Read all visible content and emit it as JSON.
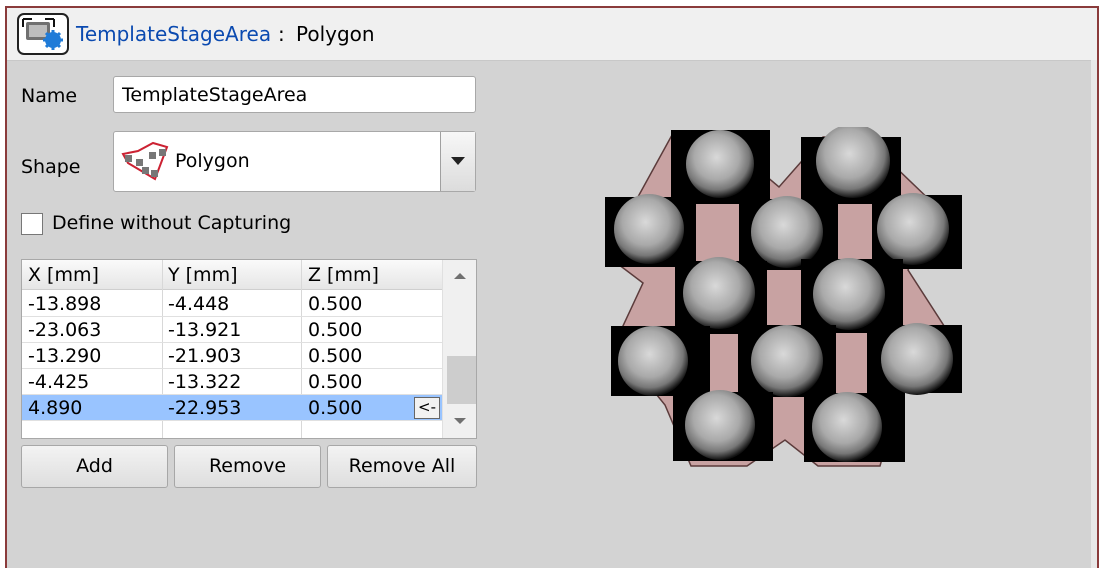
{
  "window": {
    "object_name": "TemplateStageArea",
    "separator": ":",
    "object_type": "Polygon",
    "icon": "stage-area-gear-icon"
  },
  "form": {
    "name_label": "Name",
    "name_value": "TemplateStageArea",
    "shape_label": "Shape",
    "shape_value": "Polygon",
    "shape_icon": "polygon-shape-icon",
    "define_without_capturing_label": "Define without Capturing",
    "define_without_capturing_checked": false
  },
  "coordinates": {
    "headers": [
      "X [mm]",
      "Y [mm]",
      "Z [mm]"
    ],
    "rows": [
      [
        "-13.898",
        "-4.448",
        "0.500"
      ],
      [
        "-23.063",
        "-13.921",
        "0.500"
      ],
      [
        "-13.290",
        "-21.903",
        "0.500"
      ],
      [
        "-4.425",
        "-13.322",
        "0.500"
      ],
      [
        "4.890",
        "-22.953",
        "0.500"
      ]
    ],
    "selected_row_index": 4,
    "row_action_label": "<-"
  },
  "buttons": {
    "add": "Add",
    "remove": "Remove",
    "remove_all": "Remove All"
  },
  "colors": {
    "link": "#0b4ab0",
    "selection": "#99c4ff",
    "polygon_fill": "#c8a2a2",
    "frame_border": "#8a3b3b"
  }
}
